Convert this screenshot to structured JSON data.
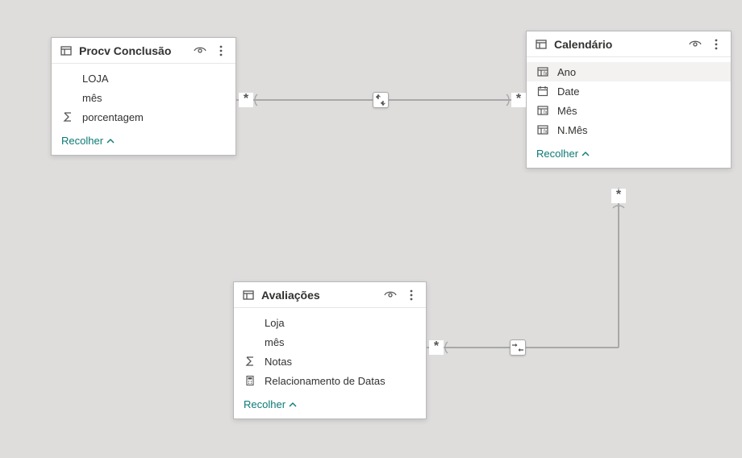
{
  "tables": {
    "procv": {
      "title": "Procv Conclusão",
      "fields": [
        {
          "icon": "blank",
          "label": "LOJA"
        },
        {
          "icon": "blank",
          "label": "mês"
        },
        {
          "icon": "sigma",
          "label": "porcentagem"
        }
      ],
      "collapse": "Recolher"
    },
    "calendario": {
      "title": "Calendário",
      "fields": [
        {
          "icon": "calc-col",
          "label": "Ano",
          "highlight": true
        },
        {
          "icon": "date",
          "label": "Date"
        },
        {
          "icon": "calc-col",
          "label": "Mês"
        },
        {
          "icon": "calc-col",
          "label": "N.Mês"
        }
      ],
      "collapse": "Recolher"
    },
    "avaliacoes": {
      "title": "Avaliações",
      "fields": [
        {
          "icon": "blank",
          "label": "Loja"
        },
        {
          "icon": "blank",
          "label": "mês"
        },
        {
          "icon": "sigma",
          "label": "Notas"
        },
        {
          "icon": "calculator",
          "label": "Relacionamento de Datas"
        }
      ],
      "collapse": "Recolher"
    }
  },
  "connectors": {
    "procv_to_cal": {
      "left_card": "many",
      "right_card": "many",
      "direction": "both"
    },
    "aval_to_cal": {
      "left_card": "many",
      "right_card": "many",
      "direction": "both"
    }
  },
  "icons": {
    "table-icon": "table-icon",
    "visibility-icon": "visibility-icon",
    "more-icon": "more-icon",
    "sigma-icon": "sigma-icon",
    "date-icon": "date-icon",
    "calc-col-icon": "calc-col-icon",
    "calculator-icon": "calculator-icon",
    "chevron-up-icon": "chevron-up-icon",
    "updown-icon": "updown-icon",
    "leftright-icon": "leftright-icon",
    "many": "*"
  }
}
